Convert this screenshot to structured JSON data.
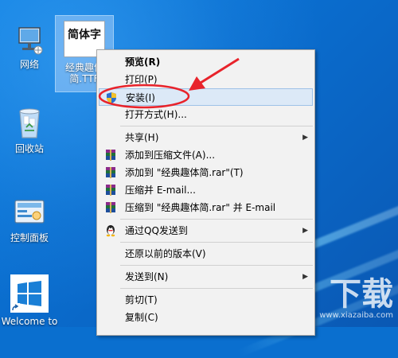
{
  "desktop": {
    "icons": [
      {
        "label": "网络",
        "icon": "network-icon"
      },
      {
        "label": "经典趣体简.TTF",
        "icon": "font-file-icon",
        "preview": "简体字"
      },
      {
        "label": "回收站",
        "icon": "recycle-bin-icon"
      },
      {
        "label": "控制面板",
        "icon": "control-panel-icon"
      },
      {
        "label": "Welcome to",
        "icon": "windows-shortcut-icon"
      }
    ]
  },
  "context_menu": {
    "items": [
      {
        "label": "预览(R)",
        "bold": true
      },
      {
        "label": "打印(P)"
      },
      {
        "label": "安装(I)",
        "icon": "uac-shield-icon",
        "highlighted": true
      },
      {
        "label": "打开方式(H)..."
      },
      {
        "label": "共享(H)",
        "submenu": true
      },
      {
        "label": "添加到压缩文件(A)...",
        "icon": "winrar-icon"
      },
      {
        "label": "添加到 \"经典趣体简.rar\"(T)",
        "icon": "winrar-icon"
      },
      {
        "label": "压缩并 E-mail...",
        "icon": "winrar-icon"
      },
      {
        "label": "压缩到 \"经典趣体简.rar\" 并 E-mail",
        "icon": "winrar-icon"
      },
      {
        "label": "通过QQ发送到",
        "icon": "qq-icon",
        "submenu": true
      },
      {
        "label": "还原以前的版本(V)"
      },
      {
        "label": "发送到(N)",
        "submenu": true
      },
      {
        "label": "剪切(T)"
      },
      {
        "label": "复制(C)"
      }
    ]
  },
  "annotation": {
    "color": "#e8232b"
  },
  "watermark": {
    "logo": "下载",
    "url": "www.xiazaiba.com"
  }
}
